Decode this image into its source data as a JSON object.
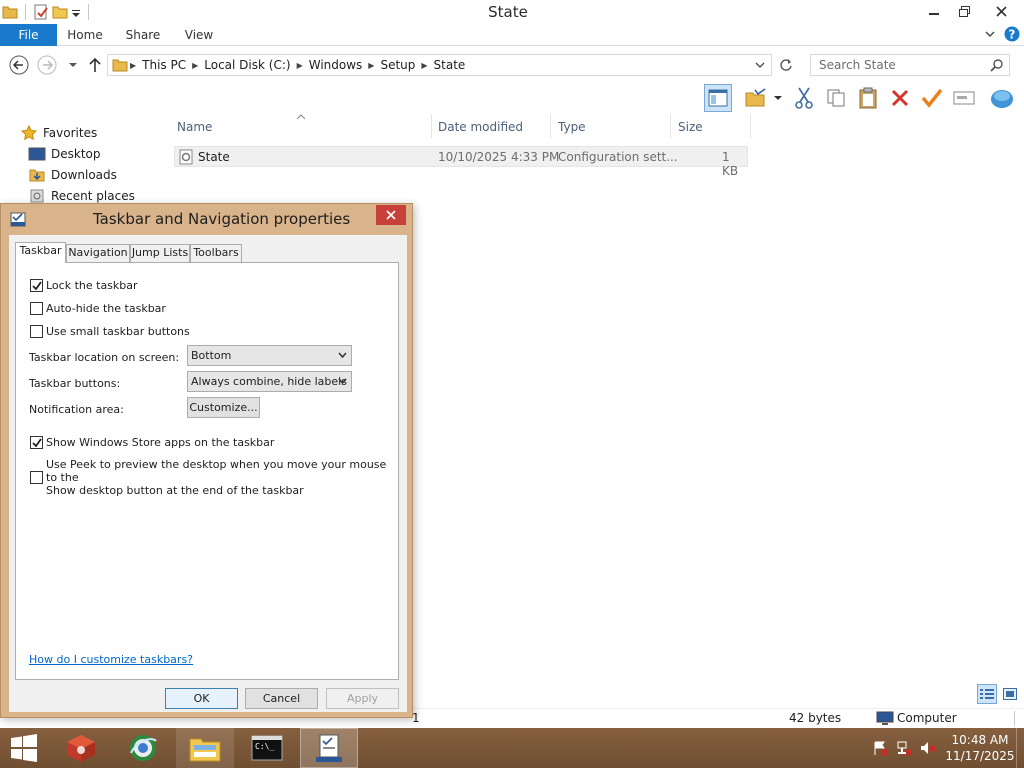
{
  "explorer": {
    "title": "State",
    "ribbon_tabs": [
      "File",
      "Home",
      "Share",
      "View"
    ],
    "breadcrumbs": [
      "This PC",
      "Local Disk (C:)",
      "Windows",
      "Setup",
      "State"
    ],
    "search_placeholder": "Search State",
    "nav": {
      "favorites": "Favorites",
      "items": [
        "Desktop",
        "Downloads",
        "Recent places"
      ]
    },
    "columns": [
      "Name",
      "Date modified",
      "Type",
      "Size"
    ],
    "files": [
      {
        "name": "State",
        "date": "10/10/2025 4:33 PM",
        "type": "Configuration sett...",
        "size": "1 KB"
      }
    ],
    "status": {
      "item_fragment": "1",
      "size": "42 bytes",
      "location": "Computer"
    }
  },
  "dialog": {
    "title": "Taskbar and Navigation properties",
    "tabs": [
      "Taskbar",
      "Navigation",
      "Jump Lists",
      "Toolbars"
    ],
    "active_tab": "Taskbar",
    "checkboxes": [
      {
        "label": "Lock the taskbar",
        "checked": true
      },
      {
        "label": "Auto-hide the taskbar",
        "checked": false
      },
      {
        "label": "Use small taskbar buttons",
        "checked": false
      },
      {
        "label": "Show Windows Store apps on the taskbar",
        "checked": true
      },
      {
        "label_line1": "Use Peek to preview the desktop when you move your mouse to the",
        "label_line2": "Show desktop button at the end of the taskbar",
        "checked": false
      }
    ],
    "location_label": "Taskbar location on screen:",
    "location_value": "Bottom",
    "buttons_label": "Taskbar buttons:",
    "buttons_value": "Always combine, hide labels",
    "notification_label": "Notification area:",
    "customize_button": "Customize...",
    "help_link": "How do I customize taskbars?",
    "ok": "OK",
    "cancel": "Cancel",
    "apply": "Apply"
  },
  "taskbar": {
    "time": "10:48 AM",
    "date": "11/17/2025"
  },
  "colors": {
    "file_tab": "#1979ca",
    "dialog_frame": "#d9b48b",
    "taskbar": "#7f5a3a",
    "close_red": "#c7413a"
  }
}
